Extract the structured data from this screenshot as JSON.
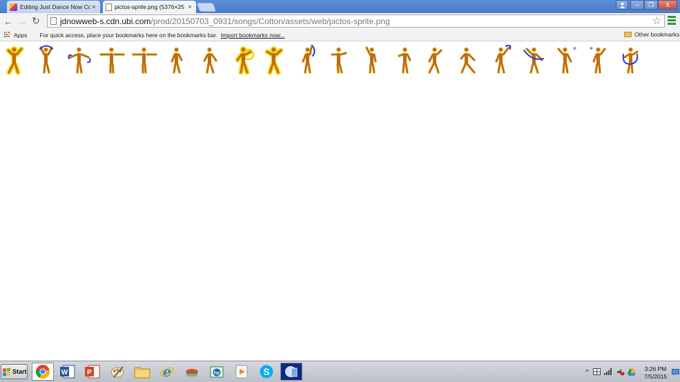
{
  "browser": {
    "tabs": [
      {
        "title": "Editing Just Dance Now Co",
        "close": "×",
        "active": false
      },
      {
        "title": "pictos-sprite.png (5376×25",
        "close": "×",
        "active": true
      }
    ],
    "window_controls": {
      "minimize": "–",
      "restore": "❐",
      "close": "X"
    },
    "nav": {
      "back": "←",
      "forward": "→",
      "reload": "↻"
    },
    "url": {
      "host": "jdnowweb-s.cdn.ubi.com",
      "path": "/prod/20150703_0931/songs/Cotton/assets/web/pictos-sprite.png"
    },
    "star": "☆"
  },
  "bookmarks": {
    "apps_label": "Apps",
    "hint": "For quick access, place your bookmarks here on the bookmarks bar.",
    "import_link": "Import bookmarks now...",
    "other_bookmarks": "Other bookmarks"
  },
  "sprite": {
    "pose_count": 20,
    "colors": {
      "body": "#c06a12",
      "glow": "#f4d200",
      "move": "#2b3ad0"
    }
  },
  "taskbar": {
    "start_label": "Start",
    "apps": [
      {
        "name": "chrome-icon"
      },
      {
        "name": "word-icon"
      },
      {
        "name": "powerpoint-icon"
      },
      {
        "name": "paint-icon"
      },
      {
        "name": "file-explorer-icon"
      },
      {
        "name": "internet-explorer-icon"
      },
      {
        "name": "mail-icon"
      },
      {
        "name": "hp-icon"
      },
      {
        "name": "media-player-icon"
      },
      {
        "name": "skype-icon"
      },
      {
        "name": "app-window-icon"
      }
    ],
    "clock": {
      "time": "3:26 PM",
      "date": "7/5/2015"
    }
  }
}
